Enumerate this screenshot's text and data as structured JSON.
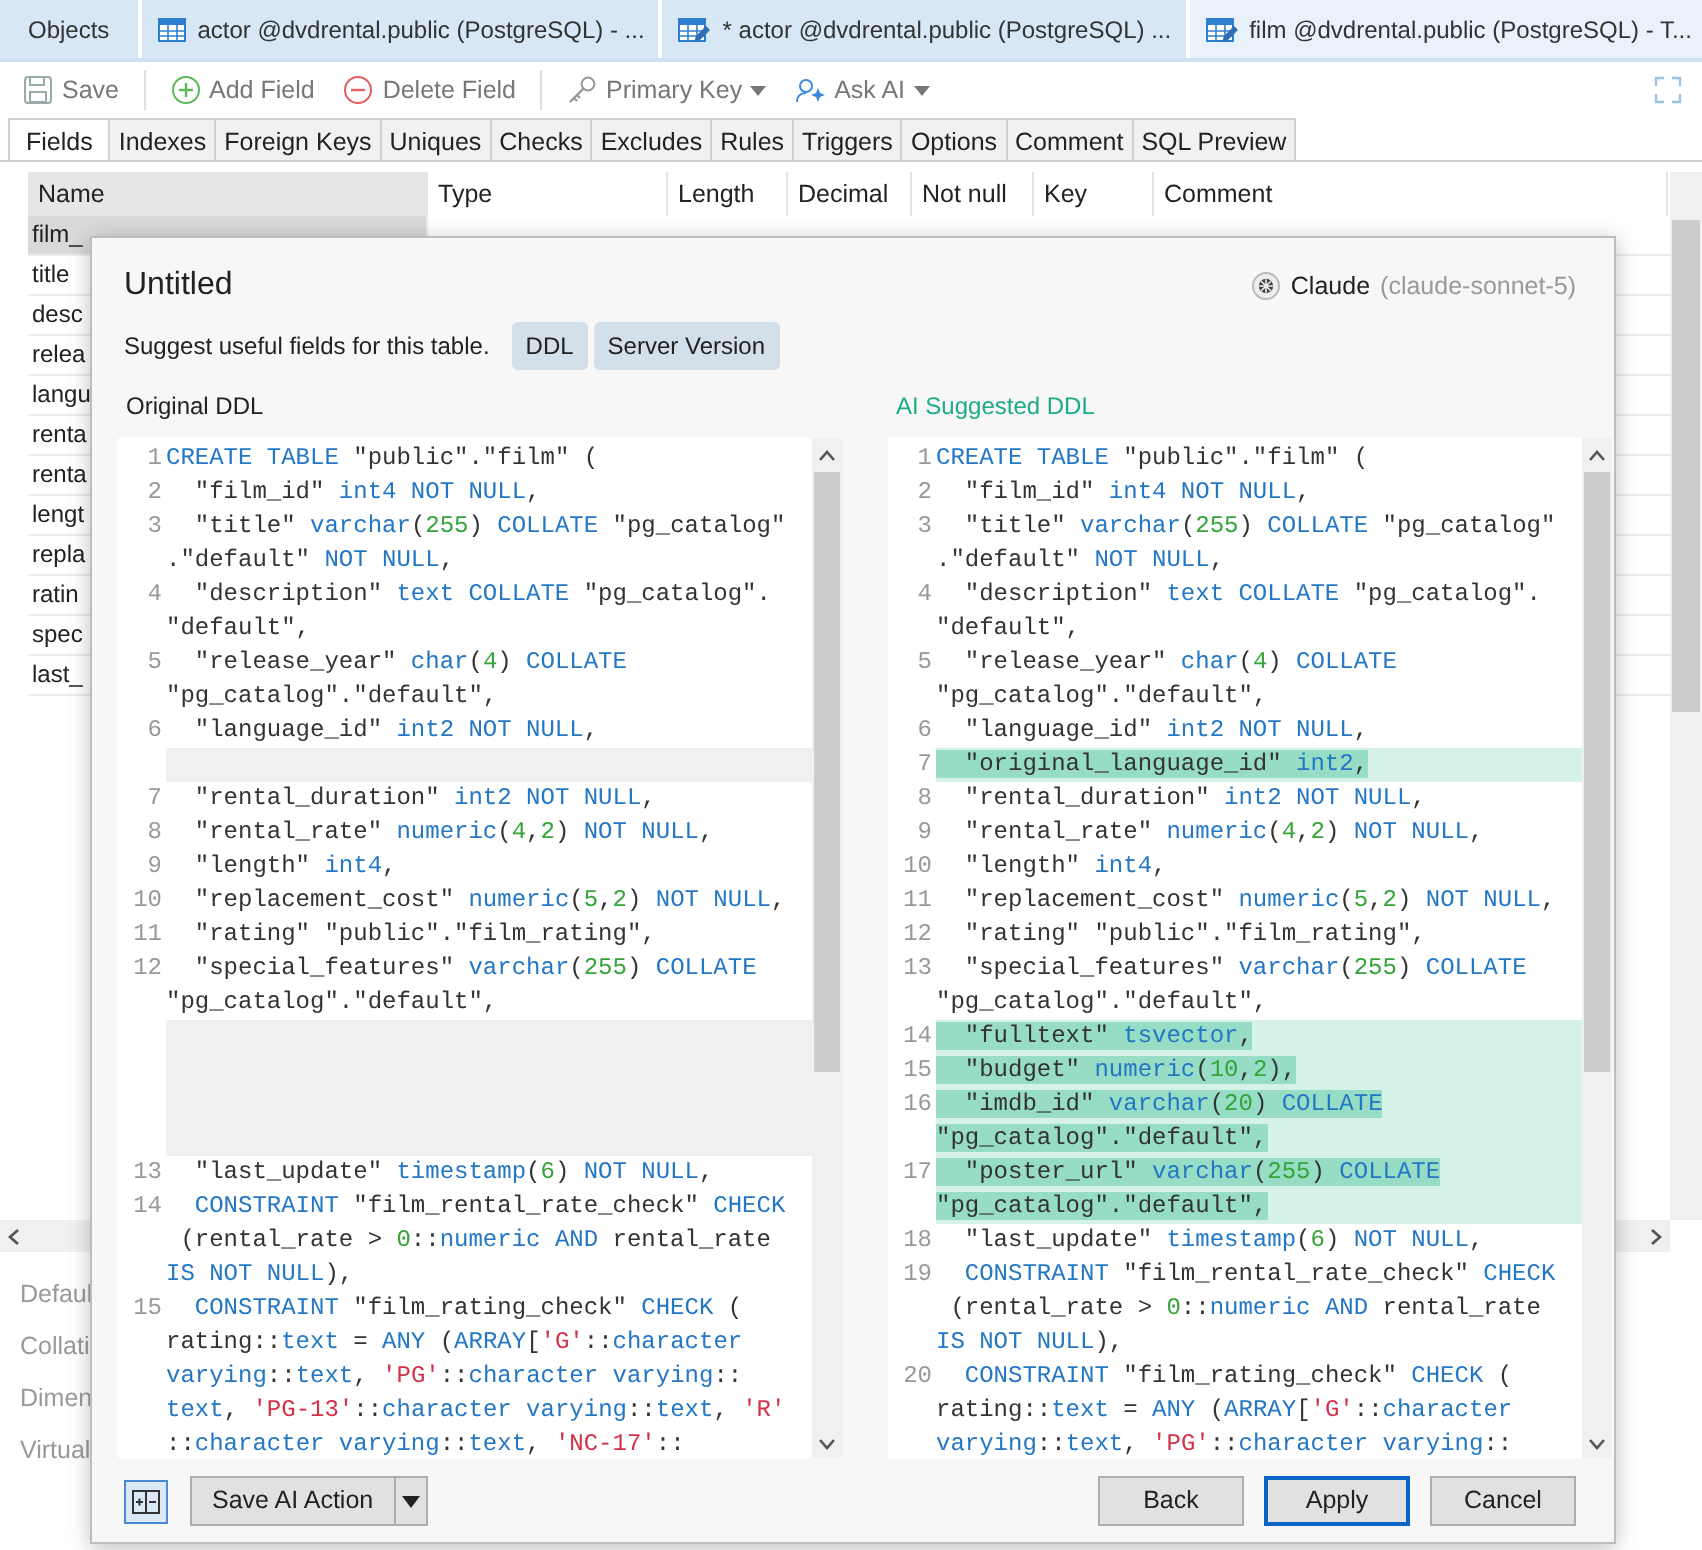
{
  "tabs": [
    {
      "label": "Objects",
      "kind": "plain",
      "selected": false
    },
    {
      "label": "actor @dvdrental.public (PostgreSQL) - ...",
      "kind": "table",
      "selected": false
    },
    {
      "label": "* actor @dvdrental.public (PostgreSQL) ...",
      "kind": "design",
      "selected": false
    },
    {
      "label": "film @dvdrental.public (PostgreSQL) - T...",
      "kind": "design",
      "selected": true
    }
  ],
  "toolbar": [
    {
      "label": "Save",
      "kind": "save",
      "dropdown": false
    },
    {
      "label": "Add Field",
      "kind": "add",
      "dropdown": false
    },
    {
      "label": "Delete Field",
      "kind": "delete",
      "dropdown": false
    },
    {
      "label": "Primary Key",
      "kind": "key",
      "dropdown": true
    },
    {
      "label": "Ask AI",
      "kind": "ai",
      "dropdown": true
    }
  ],
  "subtabs": [
    {
      "label": "Fields",
      "selected": true
    },
    {
      "label": "Indexes",
      "selected": false
    },
    {
      "label": "Foreign Keys",
      "selected": false
    },
    {
      "label": "Uniques",
      "selected": false
    },
    {
      "label": "Checks",
      "selected": false
    },
    {
      "label": "Excludes",
      "selected": false
    },
    {
      "label": "Rules",
      "selected": false
    },
    {
      "label": "Triggers",
      "selected": false
    },
    {
      "label": "Options",
      "selected": false
    },
    {
      "label": "Comment",
      "selected": false
    },
    {
      "label": "SQL Preview",
      "selected": false
    }
  ],
  "table": {
    "columns": [
      "Name",
      "Type",
      "Length",
      "Decimal",
      "Not null",
      "Key",
      "Comment"
    ],
    "rows": [
      {
        "name": "film_",
        "selected": true
      },
      {
        "name": "title",
        "selected": false
      },
      {
        "name": "desc",
        "selected": false
      },
      {
        "name": "relea",
        "selected": false
      },
      {
        "name": "langu",
        "selected": false
      },
      {
        "name": "renta",
        "selected": false
      },
      {
        "name": "renta",
        "selected": false
      },
      {
        "name": "lengt",
        "selected": false
      },
      {
        "name": "repla",
        "selected": false
      },
      {
        "name": "ratin",
        "selected": false
      },
      {
        "name": "spec",
        "selected": false
      },
      {
        "name": "last_",
        "selected": false
      }
    ]
  },
  "properties": [
    "Defaul",
    "Collati",
    "Dimen",
    "Virtual"
  ],
  "dialog": {
    "title": "Untitled",
    "prompt": "Suggest useful fields for this table.",
    "chips": [
      "DDL",
      "Server Version"
    ],
    "model": {
      "name": "Claude",
      "version": "(claude-sonnet-5)"
    },
    "original": {
      "label": "Original DDL",
      "lines": [
        {
          "kind": "code",
          "number": "1",
          "added": false,
          "rows": [
            {
              "segments": [
                {
                  "kind": "kw",
                  "text": "CREATE TABLE"
                },
                {
                  "kind": "plain",
                  "text": " \"public\".\"film\" ("
                }
              ]
            }
          ]
        },
        {
          "kind": "code",
          "number": "2",
          "added": false,
          "rows": [
            {
              "segments": [
                {
                  "kind": "plain",
                  "text": "  \"film_id\" "
                },
                {
                  "kind": "kw",
                  "text": "int4 NOT NULL"
                },
                {
                  "kind": "plain",
                  "text": ","
                }
              ]
            }
          ]
        },
        {
          "kind": "code",
          "number": "3",
          "added": false,
          "rows": [
            {
              "segments": [
                {
                  "kind": "plain",
                  "text": "  \"title\" "
                },
                {
                  "kind": "kw",
                  "text": "varchar"
                },
                {
                  "kind": "plain",
                  "text": "("
                },
                {
                  "kind": "num",
                  "text": "255"
                },
                {
                  "kind": "plain",
                  "text": ") "
                },
                {
                  "kind": "kw",
                  "text": "COLLATE"
                },
                {
                  "kind": "plain",
                  "text": " \"pg_catalog\""
                }
              ]
            },
            {
              "segments": [
                {
                  "kind": "plain",
                  "text": ".\"default\" "
                },
                {
                  "kind": "kw",
                  "text": "NOT NULL"
                },
                {
                  "kind": "plain",
                  "text": ","
                }
              ]
            }
          ]
        },
        {
          "kind": "code",
          "number": "4",
          "added": false,
          "rows": [
            {
              "segments": [
                {
                  "kind": "plain",
                  "text": "  \"description\" "
                },
                {
                  "kind": "kw",
                  "text": "text COLLATE"
                },
                {
                  "kind": "plain",
                  "text": " \"pg_catalog\"."
                }
              ]
            },
            {
              "segments": [
                {
                  "kind": "plain",
                  "text": "\"default\","
                }
              ]
            }
          ]
        },
        {
          "kind": "code",
          "number": "5",
          "added": false,
          "rows": [
            {
              "segments": [
                {
                  "kind": "plain",
                  "text": "  \"release_year\" "
                },
                {
                  "kind": "kw",
                  "text": "char"
                },
                {
                  "kind": "plain",
                  "text": "("
                },
                {
                  "kind": "num",
                  "text": "4"
                },
                {
                  "kind": "plain",
                  "text": ") "
                },
                {
                  "kind": "kw",
                  "text": "COLLATE"
                }
              ]
            },
            {
              "segments": [
                {
                  "kind": "plain",
                  "text": "\"pg_catalog\".\"default\","
                }
              ]
            }
          ]
        },
        {
          "kind": "code",
          "number": "6",
          "added": false,
          "rows": [
            {
              "segments": [
                {
                  "kind": "plain",
                  "text": "  \"language_id\" "
                },
                {
                  "kind": "kw",
                  "text": "int2 NOT NULL"
                },
                {
                  "kind": "plain",
                  "text": ","
                }
              ]
            }
          ]
        },
        {
          "kind": "gap"
        },
        {
          "kind": "code",
          "number": "7",
          "added": false,
          "rows": [
            {
              "segments": [
                {
                  "kind": "plain",
                  "text": "  \"rental_duration\" "
                },
                {
                  "kind": "kw",
                  "text": "int2 NOT NULL"
                },
                {
                  "kind": "plain",
                  "text": ","
                }
              ]
            }
          ]
        },
        {
          "kind": "code",
          "number": "8",
          "added": false,
          "rows": [
            {
              "segments": [
                {
                  "kind": "plain",
                  "text": "  \"rental_rate\" "
                },
                {
                  "kind": "kw",
                  "text": "numeric"
                },
                {
                  "kind": "plain",
                  "text": "("
                },
                {
                  "kind": "num",
                  "text": "4"
                },
                {
                  "kind": "plain",
                  "text": ","
                },
                {
                  "kind": "num",
                  "text": "2"
                },
                {
                  "kind": "plain",
                  "text": ") "
                },
                {
                  "kind": "kw",
                  "text": "NOT NULL"
                },
                {
                  "kind": "plain",
                  "text": ","
                }
              ]
            }
          ]
        },
        {
          "kind": "code",
          "number": "9",
          "added": false,
          "rows": [
            {
              "segments": [
                {
                  "kind": "plain",
                  "text": "  \"length\" "
                },
                {
                  "kind": "kw",
                  "text": "int4"
                },
                {
                  "kind": "plain",
                  "text": ","
                }
              ]
            }
          ]
        },
        {
          "kind": "code",
          "number": "10",
          "added": false,
          "rows": [
            {
              "segments": [
                {
                  "kind": "plain",
                  "text": "  \"replacement_cost\" "
                },
                {
                  "kind": "kw",
                  "text": "numeric"
                },
                {
                  "kind": "plain",
                  "text": "("
                },
                {
                  "kind": "num",
                  "text": "5"
                },
                {
                  "kind": "plain",
                  "text": ","
                },
                {
                  "kind": "num",
                  "text": "2"
                },
                {
                  "kind": "plain",
                  "text": ") "
                },
                {
                  "kind": "kw",
                  "text": "NOT NULL"
                },
                {
                  "kind": "plain",
                  "text": ","
                }
              ]
            }
          ]
        },
        {
          "kind": "code",
          "number": "11",
          "added": false,
          "rows": [
            {
              "segments": [
                {
                  "kind": "plain",
                  "text": "  \"rating\" \"public\".\"film_rating\","
                }
              ]
            }
          ]
        },
        {
          "kind": "code",
          "number": "12",
          "added": false,
          "rows": [
            {
              "segments": [
                {
                  "kind": "plain",
                  "text": "  \"special_features\" "
                },
                {
                  "kind": "kw",
                  "text": "varchar"
                },
                {
                  "kind": "plain",
                  "text": "("
                },
                {
                  "kind": "num",
                  "text": "255"
                },
                {
                  "kind": "plain",
                  "text": ") "
                },
                {
                  "kind": "kw",
                  "text": "COLLATE"
                }
              ]
            },
            {
              "segments": [
                {
                  "kind": "plain",
                  "text": "\"pg_catalog\".\"default\","
                }
              ]
            }
          ]
        },
        {
          "kind": "gap"
        },
        {
          "kind": "gap"
        },
        {
          "kind": "gap"
        },
        {
          "kind": "gap"
        },
        {
          "kind": "code",
          "number": "13",
          "added": false,
          "rows": [
            {
              "segments": [
                {
                  "kind": "plain",
                  "text": "  \"last_update\" "
                },
                {
                  "kind": "kw",
                  "text": "timestamp"
                },
                {
                  "kind": "plain",
                  "text": "("
                },
                {
                  "kind": "num",
                  "text": "6"
                },
                {
                  "kind": "plain",
                  "text": ") "
                },
                {
                  "kind": "kw",
                  "text": "NOT NULL"
                },
                {
                  "kind": "plain",
                  "text": ","
                }
              ]
            }
          ]
        },
        {
          "kind": "code",
          "number": "14",
          "added": false,
          "rows": [
            {
              "segments": [
                {
                  "kind": "kw",
                  "text": "  CONSTRAINT"
                },
                {
                  "kind": "plain",
                  "text": " \"film_rental_rate_check\" "
                },
                {
                  "kind": "kw",
                  "text": "CHECK"
                }
              ]
            },
            {
              "segments": [
                {
                  "kind": "plain",
                  "text": " (rental_rate > "
                },
                {
                  "kind": "num",
                  "text": "0"
                },
                {
                  "kind": "plain",
                  "text": "::"
                },
                {
                  "kind": "kw",
                  "text": "numeric AND"
                },
                {
                  "kind": "plain",
                  "text": " rental_rate"
                }
              ]
            },
            {
              "segments": [
                {
                  "kind": "kw",
                  "text": "IS NOT NULL"
                },
                {
                  "kind": "plain",
                  "text": "),"
                }
              ]
            }
          ]
        },
        {
          "kind": "code",
          "number": "15",
          "added": false,
          "rows": [
            {
              "segments": [
                {
                  "kind": "kw",
                  "text": "  CONSTRAINT"
                },
                {
                  "kind": "plain",
                  "text": " \"film_rating_check\" "
                },
                {
                  "kind": "kw",
                  "text": "CHECK"
                },
                {
                  "kind": "plain",
                  "text": " ("
                }
              ]
            },
            {
              "segments": [
                {
                  "kind": "plain",
                  "text": "rating::"
                },
                {
                  "kind": "kw",
                  "text": "text"
                },
                {
                  "kind": "plain",
                  "text": " = "
                },
                {
                  "kind": "kw",
                  "text": "ANY"
                },
                {
                  "kind": "plain",
                  "text": " ("
                },
                {
                  "kind": "kw",
                  "text": "ARRAY"
                },
                {
                  "kind": "plain",
                  "text": "["
                },
                {
                  "kind": "str",
                  "text": "'G'"
                },
                {
                  "kind": "plain",
                  "text": "::"
                },
                {
                  "kind": "kw",
                  "text": "character"
                }
              ]
            },
            {
              "segments": [
                {
                  "kind": "kw",
                  "text": "varying"
                },
                {
                  "kind": "plain",
                  "text": "::"
                },
                {
                  "kind": "kw",
                  "text": "text"
                },
                {
                  "kind": "plain",
                  "text": ", "
                },
                {
                  "kind": "str",
                  "text": "'PG'"
                },
                {
                  "kind": "plain",
                  "text": "::"
                },
                {
                  "kind": "kw",
                  "text": "character varying"
                },
                {
                  "kind": "plain",
                  "text": "::"
                }
              ]
            },
            {
              "segments": [
                {
                  "kind": "kw",
                  "text": "text"
                },
                {
                  "kind": "plain",
                  "text": ", "
                },
                {
                  "kind": "str",
                  "text": "'PG-13'"
                },
                {
                  "kind": "plain",
                  "text": "::"
                },
                {
                  "kind": "kw",
                  "text": "character varying"
                },
                {
                  "kind": "plain",
                  "text": "::"
                },
                {
                  "kind": "kw",
                  "text": "text"
                },
                {
                  "kind": "plain",
                  "text": ", "
                },
                {
                  "kind": "str",
                  "text": "'R'"
                }
              ]
            },
            {
              "segments": [
                {
                  "kind": "plain",
                  "text": "::"
                },
                {
                  "kind": "kw",
                  "text": "character varying"
                },
                {
                  "kind": "plain",
                  "text": "::"
                },
                {
                  "kind": "kw",
                  "text": "text"
                },
                {
                  "kind": "plain",
                  "text": ", "
                },
                {
                  "kind": "str",
                  "text": "'NC-17'"
                },
                {
                  "kind": "plain",
                  "text": "::"
                }
              ]
            }
          ]
        }
      ]
    },
    "suggested": {
      "label": "AI Suggested DDL",
      "lines": [
        {
          "kind": "code",
          "number": "1",
          "added": false,
          "rows": [
            {
              "segments": [
                {
                  "kind": "kw",
                  "text": "CREATE TABLE"
                },
                {
                  "kind": "plain",
                  "text": " \"public\".\"film\" ("
                }
              ]
            }
          ]
        },
        {
          "kind": "code",
          "number": "2",
          "added": false,
          "rows": [
            {
              "segments": [
                {
                  "kind": "plain",
                  "text": "  \"film_id\" "
                },
                {
                  "kind": "kw",
                  "text": "int4 NOT NULL"
                },
                {
                  "kind": "plain",
                  "text": ","
                }
              ]
            }
          ]
        },
        {
          "kind": "code",
          "number": "3",
          "added": false,
          "rows": [
            {
              "segments": [
                {
                  "kind": "plain",
                  "text": "  \"title\" "
                },
                {
                  "kind": "kw",
                  "text": "varchar"
                },
                {
                  "kind": "plain",
                  "text": "("
                },
                {
                  "kind": "num",
                  "text": "255"
                },
                {
                  "kind": "plain",
                  "text": ") "
                },
                {
                  "kind": "kw",
                  "text": "COLLATE"
                },
                {
                  "kind": "plain",
                  "text": " \"pg_catalog\""
                }
              ]
            },
            {
              "segments": [
                {
                  "kind": "plain",
                  "text": ".\"default\" "
                },
                {
                  "kind": "kw",
                  "text": "NOT NULL"
                },
                {
                  "kind": "plain",
                  "text": ","
                }
              ]
            }
          ]
        },
        {
          "kind": "code",
          "number": "4",
          "added": false,
          "rows": [
            {
              "segments": [
                {
                  "kind": "plain",
                  "text": "  \"description\" "
                },
                {
                  "kind": "kw",
                  "text": "text COLLATE"
                },
                {
                  "kind": "plain",
                  "text": " \"pg_catalog\"."
                }
              ]
            },
            {
              "segments": [
                {
                  "kind": "plain",
                  "text": "\"default\","
                }
              ]
            }
          ]
        },
        {
          "kind": "code",
          "number": "5",
          "added": false,
          "rows": [
            {
              "segments": [
                {
                  "kind": "plain",
                  "text": "  \"release_year\" "
                },
                {
                  "kind": "kw",
                  "text": "char"
                },
                {
                  "kind": "plain",
                  "text": "("
                },
                {
                  "kind": "num",
                  "text": "4"
                },
                {
                  "kind": "plain",
                  "text": ") "
                },
                {
                  "kind": "kw",
                  "text": "COLLATE"
                }
              ]
            },
            {
              "segments": [
                {
                  "kind": "plain",
                  "text": "\"pg_catalog\".\"default\","
                }
              ]
            }
          ]
        },
        {
          "kind": "code",
          "number": "6",
          "added": false,
          "rows": [
            {
              "segments": [
                {
                  "kind": "plain",
                  "text": "  \"language_id\" "
                },
                {
                  "kind": "kw",
                  "text": "int2 NOT NULL"
                },
                {
                  "kind": "plain",
                  "text": ","
                }
              ]
            }
          ]
        },
        {
          "kind": "code",
          "number": "7",
          "added": true,
          "rows": [
            {
              "segments": [
                {
                  "kind": "plain",
                  "text": "  \"original_language_id\" "
                },
                {
                  "kind": "kw",
                  "text": "int2"
                },
                {
                  "kind": "plain",
                  "text": ","
                }
              ]
            }
          ]
        },
        {
          "kind": "code",
          "number": "8",
          "added": false,
          "rows": [
            {
              "segments": [
                {
                  "kind": "plain",
                  "text": "  \"rental_duration\" "
                },
                {
                  "kind": "kw",
                  "text": "int2 NOT NULL"
                },
                {
                  "kind": "plain",
                  "text": ","
                }
              ]
            }
          ]
        },
        {
          "kind": "code",
          "number": "9",
          "added": false,
          "rows": [
            {
              "segments": [
                {
                  "kind": "plain",
                  "text": "  \"rental_rate\" "
                },
                {
                  "kind": "kw",
                  "text": "numeric"
                },
                {
                  "kind": "plain",
                  "text": "("
                },
                {
                  "kind": "num",
                  "text": "4"
                },
                {
                  "kind": "plain",
                  "text": ","
                },
                {
                  "kind": "num",
                  "text": "2"
                },
                {
                  "kind": "plain",
                  "text": ") "
                },
                {
                  "kind": "kw",
                  "text": "NOT NULL"
                },
                {
                  "kind": "plain",
                  "text": ","
                }
              ]
            }
          ]
        },
        {
          "kind": "code",
          "number": "10",
          "added": false,
          "rows": [
            {
              "segments": [
                {
                  "kind": "plain",
                  "text": "  \"length\" "
                },
                {
                  "kind": "kw",
                  "text": "int4"
                },
                {
                  "kind": "plain",
                  "text": ","
                }
              ]
            }
          ]
        },
        {
          "kind": "code",
          "number": "11",
          "added": false,
          "rows": [
            {
              "segments": [
                {
                  "kind": "plain",
                  "text": "  \"replacement_cost\" "
                },
                {
                  "kind": "kw",
                  "text": "numeric"
                },
                {
                  "kind": "plain",
                  "text": "("
                },
                {
                  "kind": "num",
                  "text": "5"
                },
                {
                  "kind": "plain",
                  "text": ","
                },
                {
                  "kind": "num",
                  "text": "2"
                },
                {
                  "kind": "plain",
                  "text": ") "
                },
                {
                  "kind": "kw",
                  "text": "NOT NULL"
                },
                {
                  "kind": "plain",
                  "text": ","
                }
              ]
            }
          ]
        },
        {
          "kind": "code",
          "number": "12",
          "added": false,
          "rows": [
            {
              "segments": [
                {
                  "kind": "plain",
                  "text": "  \"rating\" \"public\".\"film_rating\","
                }
              ]
            }
          ]
        },
        {
          "kind": "code",
          "number": "13",
          "added": false,
          "rows": [
            {
              "segments": [
                {
                  "kind": "plain",
                  "text": "  \"special_features\" "
                },
                {
                  "kind": "kw",
                  "text": "varchar"
                },
                {
                  "kind": "plain",
                  "text": "("
                },
                {
                  "kind": "num",
                  "text": "255"
                },
                {
                  "kind": "plain",
                  "text": ") "
                },
                {
                  "kind": "kw",
                  "text": "COLLATE"
                }
              ]
            },
            {
              "segments": [
                {
                  "kind": "plain",
                  "text": "\"pg_catalog\".\"default\","
                }
              ]
            }
          ]
        },
        {
          "kind": "code",
          "number": "14",
          "added": true,
          "rows": [
            {
              "segments": [
                {
                  "kind": "plain",
                  "text": "  \"fulltext\" "
                },
                {
                  "kind": "kw",
                  "text": "tsvector"
                },
                {
                  "kind": "plain",
                  "text": ","
                }
              ]
            }
          ]
        },
        {
          "kind": "code",
          "number": "15",
          "added": true,
          "rows": [
            {
              "segments": [
                {
                  "kind": "plain",
                  "text": "  \"budget\" "
                },
                {
                  "kind": "kw",
                  "text": "numeric"
                },
                {
                  "kind": "plain",
                  "text": "("
                },
                {
                  "kind": "num",
                  "text": "10"
                },
                {
                  "kind": "plain",
                  "text": ","
                },
                {
                  "kind": "num",
                  "text": "2"
                },
                {
                  "kind": "plain",
                  "text": "),"
                }
              ]
            }
          ]
        },
        {
          "kind": "code",
          "number": "16",
          "added": true,
          "rows": [
            {
              "segments": [
                {
                  "kind": "plain",
                  "text": "  \"imdb_id\" "
                },
                {
                  "kind": "kw",
                  "text": "varchar"
                },
                {
                  "kind": "plain",
                  "text": "("
                },
                {
                  "kind": "num",
                  "text": "20"
                },
                {
                  "kind": "plain",
                  "text": ") "
                },
                {
                  "kind": "kw",
                  "text": "COLLATE"
                }
              ]
            },
            {
              "segments": [
                {
                  "kind": "plain",
                  "text": "\"pg_catalog\".\"default\","
                }
              ]
            }
          ]
        },
        {
          "kind": "code",
          "number": "17",
          "added": true,
          "rows": [
            {
              "segments": [
                {
                  "kind": "plain",
                  "text": "  \"poster_url\" "
                },
                {
                  "kind": "kw",
                  "text": "varchar"
                },
                {
                  "kind": "plain",
                  "text": "("
                },
                {
                  "kind": "num",
                  "text": "255"
                },
                {
                  "kind": "plain",
                  "text": ") "
                },
                {
                  "kind": "kw",
                  "text": "COLLATE"
                }
              ]
            },
            {
              "segments": [
                {
                  "kind": "plain",
                  "text": "\"pg_catalog\".\"default\","
                }
              ]
            }
          ]
        },
        {
          "kind": "code",
          "number": "18",
          "added": false,
          "rows": [
            {
              "segments": [
                {
                  "kind": "plain",
                  "text": "  \"last_update\" "
                },
                {
                  "kind": "kw",
                  "text": "timestamp"
                },
                {
                  "kind": "plain",
                  "text": "("
                },
                {
                  "kind": "num",
                  "text": "6"
                },
                {
                  "kind": "plain",
                  "text": ") "
                },
                {
                  "kind": "kw",
                  "text": "NOT NULL"
                },
                {
                  "kind": "plain",
                  "text": ","
                }
              ]
            }
          ]
        },
        {
          "kind": "code",
          "number": "19",
          "added": false,
          "rows": [
            {
              "segments": [
                {
                  "kind": "kw",
                  "text": "  CONSTRAINT"
                },
                {
                  "kind": "plain",
                  "text": " \"film_rental_rate_check\" "
                },
                {
                  "kind": "kw",
                  "text": "CHECK"
                }
              ]
            },
            {
              "segments": [
                {
                  "kind": "plain",
                  "text": " (rental_rate > "
                },
                {
                  "kind": "num",
                  "text": "0"
                },
                {
                  "kind": "plain",
                  "text": "::"
                },
                {
                  "kind": "kw",
                  "text": "numeric AND"
                },
                {
                  "kind": "plain",
                  "text": " rental_rate"
                }
              ]
            },
            {
              "segments": [
                {
                  "kind": "kw",
                  "text": "IS NOT NULL"
                },
                {
                  "kind": "plain",
                  "text": "),"
                }
              ]
            }
          ]
        },
        {
          "kind": "code",
          "number": "20",
          "added": false,
          "rows": [
            {
              "segments": [
                {
                  "kind": "kw",
                  "text": "  CONSTRAINT"
                },
                {
                  "kind": "plain",
                  "text": " \"film_rating_check\" "
                },
                {
                  "kind": "kw",
                  "text": "CHECK"
                },
                {
                  "kind": "plain",
                  "text": " ("
                }
              ]
            },
            {
              "segments": [
                {
                  "kind": "plain",
                  "text": "rating::"
                },
                {
                  "kind": "kw",
                  "text": "text"
                },
                {
                  "kind": "plain",
                  "text": " = "
                },
                {
                  "kind": "kw",
                  "text": "ANY"
                },
                {
                  "kind": "plain",
                  "text": " ("
                },
                {
                  "kind": "kw",
                  "text": "ARRAY"
                },
                {
                  "kind": "plain",
                  "text": "["
                },
                {
                  "kind": "str",
                  "text": "'G'"
                },
                {
                  "kind": "plain",
                  "text": "::"
                },
                {
                  "kind": "kw",
                  "text": "character"
                }
              ]
            },
            {
              "segments": [
                {
                  "kind": "kw",
                  "text": "varying"
                },
                {
                  "kind": "plain",
                  "text": "::"
                },
                {
                  "kind": "kw",
                  "text": "text"
                },
                {
                  "kind": "plain",
                  "text": ", "
                },
                {
                  "kind": "str",
                  "text": "'PG'"
                },
                {
                  "kind": "plain",
                  "text": "::"
                },
                {
                  "kind": "kw",
                  "text": "character varying"
                },
                {
                  "kind": "plain",
                  "text": "::"
                }
              ]
            }
          ]
        }
      ]
    },
    "save_action": "Save AI Action",
    "buttons": [
      {
        "label": "Back",
        "default": false
      },
      {
        "label": "Apply",
        "default": true
      },
      {
        "label": "Cancel",
        "default": false
      }
    ]
  }
}
